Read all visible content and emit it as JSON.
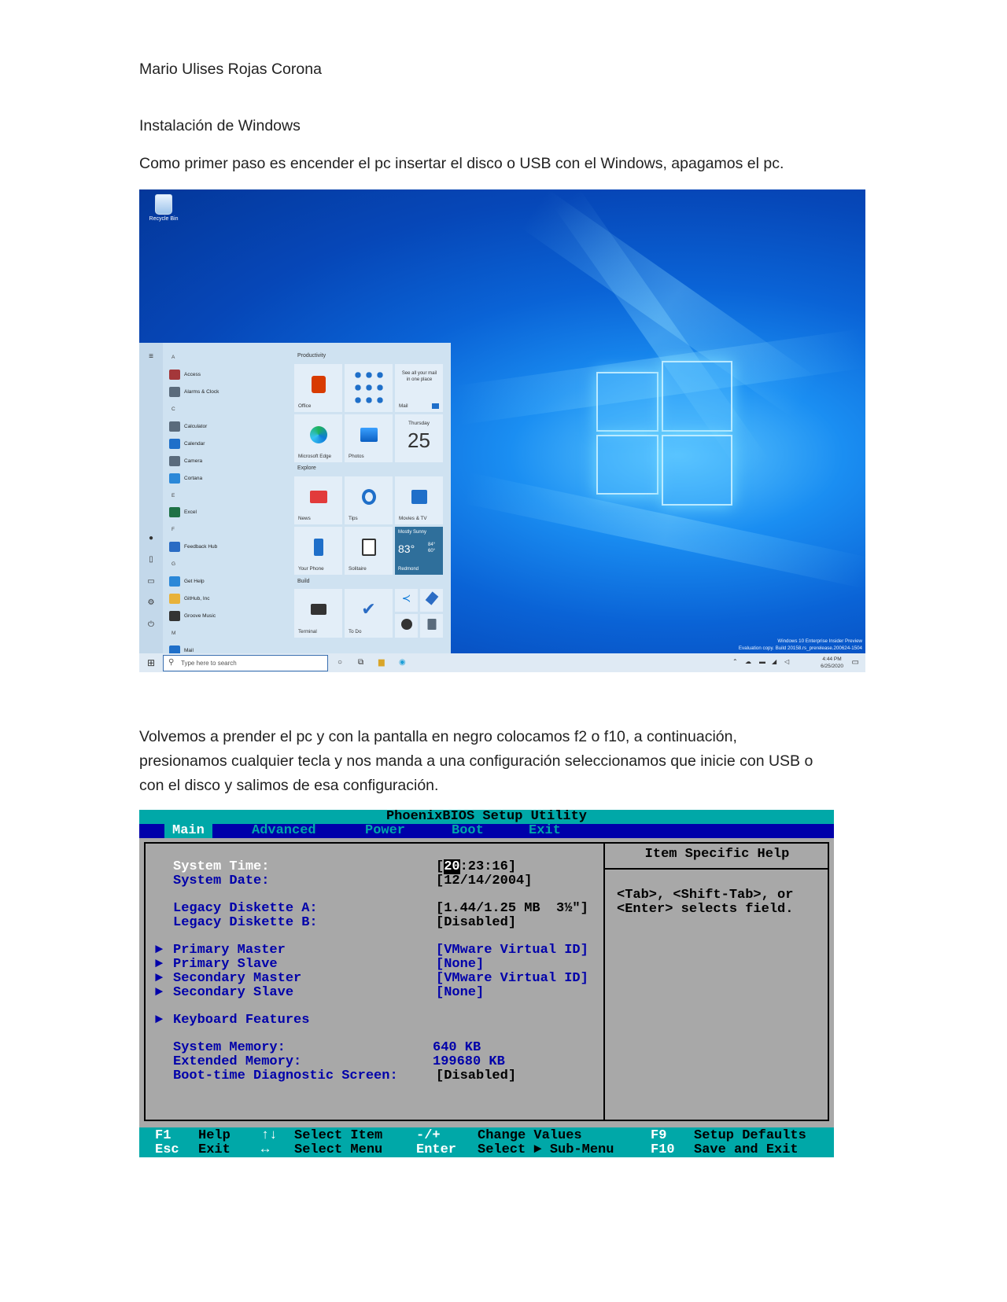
{
  "document": {
    "author": "Mario Ulises Rojas Corona",
    "heading": "Instalación de Windows",
    "para1": "Como primer paso es encender el pc insertar el disco o USB con el Windows, apagamos el pc.",
    "para2_line1": "Volvemos a prender el pc y con la pantalla en negro colocamos f2 o f10, a continuación,",
    "para2_line2": "presionamos cualquier tecla y nos manda a una configuración seleccionamos que inicie con USB o",
    "para2_line3": "con el disco y salimos de esa configuración."
  },
  "windows": {
    "recycle_bin": "Recycle Bin",
    "app_list": [
      {
        "label": "A",
        "header": true
      },
      {
        "label": "Access",
        "color": "#a4373a"
      },
      {
        "label": "Alarms & Clock",
        "color": "#5a6b7c"
      },
      {
        "label": "C",
        "header": true
      },
      {
        "label": "Calculator",
        "color": "#5a6b7c"
      },
      {
        "label": "Calendar",
        "color": "#1f6fc9"
      },
      {
        "label": "Camera",
        "color": "#5a6b7c"
      },
      {
        "label": "Cortana",
        "color": "#2b88d8"
      },
      {
        "label": "E",
        "header": true
      },
      {
        "label": "Excel",
        "color": "#1e7145"
      },
      {
        "label": "F",
        "header": true
      },
      {
        "label": "Feedback Hub",
        "color": "#2b6cc4"
      },
      {
        "label": "G",
        "header": true
      },
      {
        "label": "Get Help",
        "color": "#2b88d8"
      },
      {
        "label": "GitHub, Inc",
        "color": "#e8b23a"
      },
      {
        "label": "Groove Music",
        "color": "#333333"
      },
      {
        "label": "M",
        "header": true
      },
      {
        "label": "Mail",
        "color": "#1f6fc9"
      }
    ],
    "groups": {
      "productivity": "Productivity",
      "explore": "Explore",
      "build": "Build"
    },
    "tiles": {
      "office": "Office",
      "mail_promo": "See all your mail in one place",
      "mail": "Mail",
      "edge": "Microsoft Edge",
      "photos": "Photos",
      "day": "Thursday",
      "date": "25",
      "news": "News",
      "tips": "Tips",
      "movies": "Movies & TV",
      "weather_cond": "Mostly Sunny",
      "weather_temp": "83°",
      "weather_hi": "84°",
      "weather_lo": "60°",
      "weather_city": "Redmond",
      "phone": "Your Phone",
      "solitaire": "Solitaire",
      "terminal": "Terminal",
      "todo": "To Do"
    },
    "search_placeholder": "Type here to search",
    "time": "4:44 PM",
    "date_str": "6/25/2020",
    "watermark_1": "Windows 10 Enterprise Insider Preview",
    "watermark_2": "Evaluation copy. Build 20158.rs_prerelease.200624-1504"
  },
  "bios": {
    "title": "PhoenixBIOS Setup Utility",
    "menu": [
      "Main",
      "Advanced",
      "Power",
      "Boot",
      "Exit"
    ],
    "help_title": "Item Specific Help",
    "help_text": "<Tab>, <Shift-Tab>, or\n<Enter> selects field.",
    "time_label": "System Time:",
    "time_hour": "20",
    "time_rest": ":23:16]",
    "date_label": "System Date:",
    "date_value": "[12/14/2004]",
    "floppy_a_label": "Legacy Diskette A:",
    "floppy_a_value": "[1.44/1.25 MB  3½\"]",
    "floppy_b_label": "Legacy Diskette B:",
    "floppy_b_value": "[Disabled]",
    "pm_label": "Primary Master",
    "pm_value": "[VMware Virtual ID]",
    "ps_label": "Primary Slave",
    "ps_value": "[None]",
    "sm_label": "Secondary Master",
    "sm_value": "[VMware Virtual ID]",
    "ss_label": "Secondary Slave",
    "ss_value": "[None]",
    "kb_label": "Keyboard Features",
    "sysmem_label": "System Memory:",
    "sysmem_value": "640 KB",
    "extmem_label": "Extended Memory:",
    "extmem_value": "199680 KB",
    "diag_label": "Boot-time Diagnostic Screen:",
    "diag_value": "[Disabled]",
    "footer": {
      "f1": "F1",
      "f1d": "Help",
      "ud": "↑↓",
      "udd": "Select Item",
      "pm": "-/+",
      "pmd": "Change Values",
      "f9": "F9",
      "f9d": "Setup Defaults",
      "esc": "Esc",
      "escd": "Exit",
      "lr": "↔",
      "lrd": "Select Menu",
      "enter": "Enter",
      "enterd": "Select ► Sub-Menu",
      "f10": "F10",
      "f10d": "Save and Exit"
    }
  }
}
